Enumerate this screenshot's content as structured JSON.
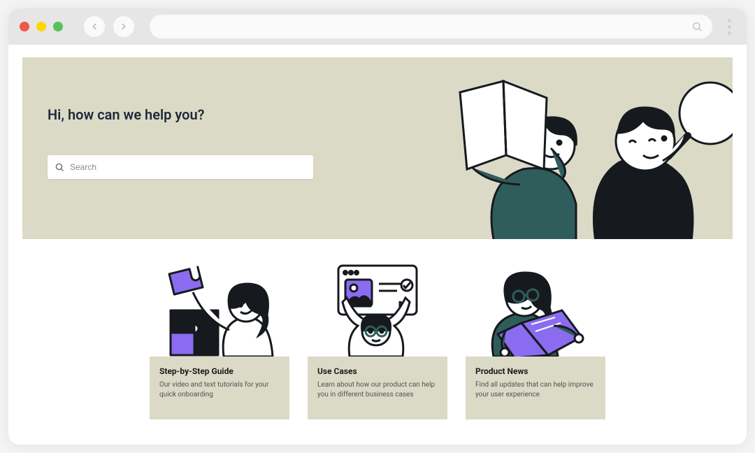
{
  "hero": {
    "title": "Hi, how can we help you?",
    "search_placeholder": "Search"
  },
  "cards": [
    {
      "title": "Step-by-Step Guide",
      "desc": "Our video and text tutorials for your quick onboarding"
    },
    {
      "title": "Use Cases",
      "desc": "Learn about how our product can help you in different business cases"
    },
    {
      "title": "Product News",
      "desc": "Find all updates that can help improve your user experience"
    }
  ],
  "colors": {
    "teal": "#2f5d5c",
    "purple": "#8b6cf0",
    "sage": "#dbdac7",
    "ink": "#161a1f"
  }
}
